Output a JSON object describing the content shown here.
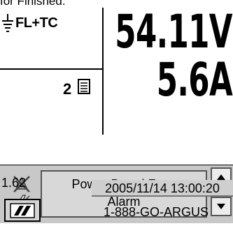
{
  "header": {
    "cut_text": "for Finished."
  },
  "status": {
    "mode_label": "FL+TC",
    "alarm_count": "2"
  },
  "readings": {
    "voltage": "54.11V",
    "current": "5.6A"
  },
  "alarm": {
    "line1": "Power Board Fuse",
    "line2": "Alarm"
  },
  "footer": {
    "version": "1.62",
    "datetime": "2005/11/14 13:00:20",
    "phone": "1-888-GO-ARGUS"
  },
  "icons": {
    "mode": "ground-terminal-icon",
    "doc": "document-icon",
    "mute": "alarm-mute-icon",
    "power": "lightning-icon",
    "up": "scroll-up-icon",
    "down": "scroll-down-icon",
    "logo": "argus-logo-icon"
  }
}
